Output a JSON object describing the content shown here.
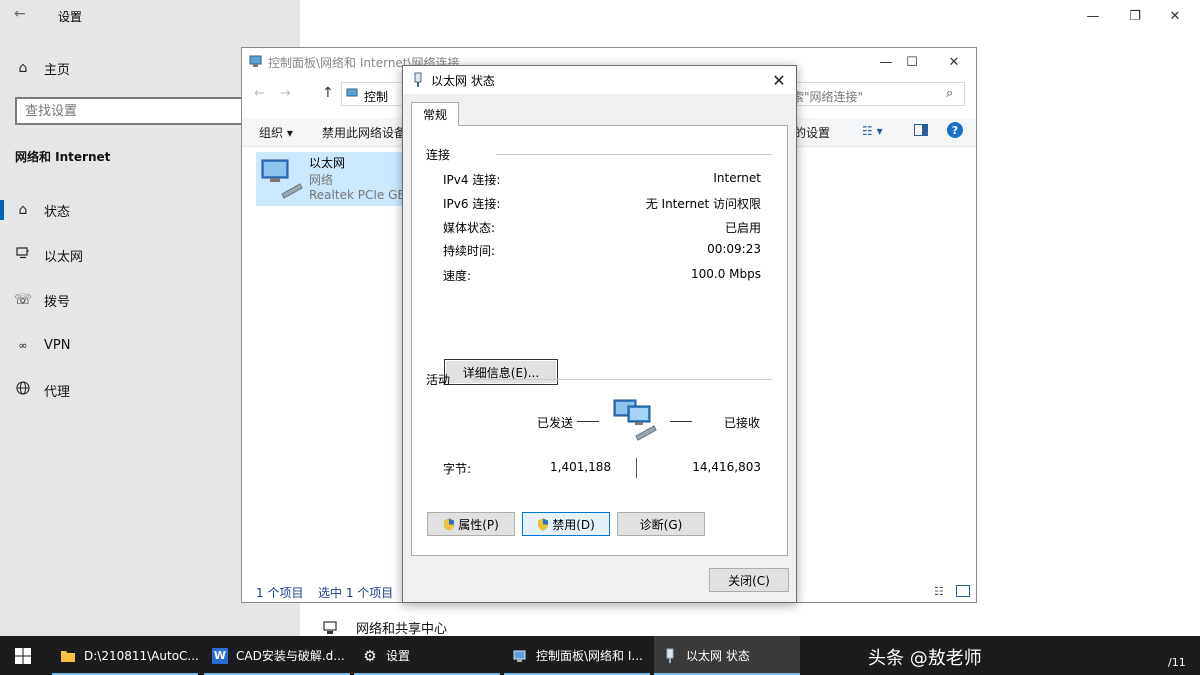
{
  "settings": {
    "title": "设置",
    "home_label": "主页",
    "search_placeholder": "查找设置",
    "section_title": "网络和 Internet",
    "nav": [
      {
        "label": "状态",
        "icon": "home-status-icon"
      },
      {
        "label": "以太网",
        "icon": "monitor-icon"
      },
      {
        "label": "拨号",
        "icon": "dialup-icon"
      },
      {
        "label": "VPN",
        "icon": "vpn-icon"
      },
      {
        "label": "代理",
        "icon": "globe-icon"
      }
    ],
    "partial_link": "网络和共享中心"
  },
  "explorer": {
    "title": "控制面板\\网络和 Internet\\网络连接",
    "address": "控制",
    "search_placeholder": "索\"网络连接\"",
    "toolbar": {
      "organize": "组织 ▾",
      "disable": "禁用此网络设备",
      "settings_partial": "的设置"
    },
    "item": {
      "name": "以太网",
      "status": "网络",
      "adapter": "Realtek PCIe GBE"
    },
    "status_count": "1 个项目",
    "status_selected": "选中 1 个项目"
  },
  "dialog": {
    "title": "以太网 状态",
    "tab": "常规",
    "connection_group": "连接",
    "rows": [
      {
        "key": "IPv4 连接:",
        "value": "Internet"
      },
      {
        "key": "IPv6 连接:",
        "value": "无 Internet 访问权限"
      },
      {
        "key": "媒体状态:",
        "value": "已启用"
      },
      {
        "key": "持续时间:",
        "value": "00:09:23"
      },
      {
        "key": "速度:",
        "value": "100.0 Mbps"
      }
    ],
    "details_button": "详细信息(E)...",
    "activity_group": "活动",
    "sent_label": "已发送",
    "received_label": "已接收",
    "bytes_label": "字节:",
    "bytes_sent": "1,401,188",
    "bytes_received": "14,416,803",
    "properties_button": "属性(P)",
    "disable_button": "禁用(D)",
    "diagnose_button": "诊断(G)",
    "close_button": "关闭(C)"
  },
  "taskbar": {
    "items": [
      {
        "label": "D:\\210811\\AutoC..."
      },
      {
        "label": "CAD安装与破解.d..."
      },
      {
        "label": "设置"
      },
      {
        "label": "控制面板\\网络和 I..."
      },
      {
        "label": "以太网 状态"
      }
    ],
    "watermark": "头条 @敖老师",
    "clock_partial": "/11"
  },
  "colors": {
    "accent": "#0063b1",
    "taskbar": "#1c1c1c",
    "selection": "#cce8ff"
  }
}
